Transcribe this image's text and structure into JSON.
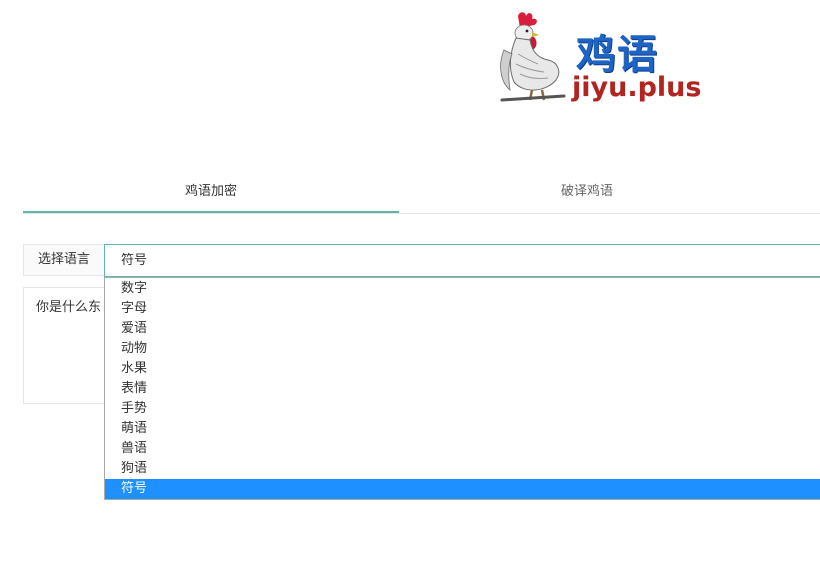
{
  "logo": {
    "title_cn": "鸡语",
    "domain": "jiyu.plus",
    "icon": "rooster-icon"
  },
  "tabs": [
    {
      "label": "鸡语加密",
      "active": true
    },
    {
      "label": "破译鸡语",
      "active": false
    }
  ],
  "form": {
    "language_label": "选择语言",
    "selected_language": "符号",
    "input_text": "你是什么东"
  },
  "dropdown": {
    "options": [
      "数字",
      "字母",
      "爱语",
      "动物",
      "水果",
      "表情",
      "手势",
      "萌语",
      "兽语",
      "狗语",
      "符号"
    ],
    "selected_index": 10
  },
  "colors": {
    "accent": "#5fb8a7",
    "selected_bg": "#1e90ff",
    "brand_blue": "#1e63c6",
    "brand_red": "#b3241f"
  }
}
